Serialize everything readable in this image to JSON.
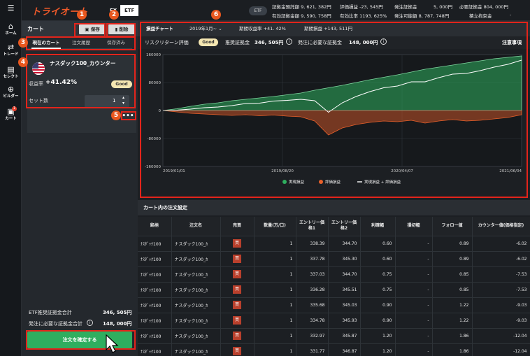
{
  "app": {
    "logo": "トライオート",
    "mode_fx": "FX",
    "mode_etf": "ETF",
    "etf_pill": "ETF"
  },
  "colors": {
    "accent": "#ef5a2a",
    "green": "#2fae5f",
    "red": "#e3241b",
    "panel": "#24282d"
  },
  "rail": [
    {
      "icon": "home-icon",
      "glyph": "⌂",
      "label": "ホーム"
    },
    {
      "icon": "trade-icon",
      "glyph": "⇄",
      "label": "トレード"
    },
    {
      "icon": "select-icon",
      "glyph": "▤",
      "label": "セレクト"
    },
    {
      "icon": "builder-icon",
      "glyph": "⊕",
      "label": "ビルダー"
    },
    {
      "icon": "cart-icon",
      "glyph": "🛒",
      "label": "カート",
      "badge": "1"
    }
  ],
  "summary": {
    "r1c1": "証拠金預託額 9, 621, 382円",
    "r1c2": "評価損益 -23, 545円",
    "r1c3": "発注証拠金",
    "r1c3v": "5, 000円",
    "r1c4": "必要証拠金 804, 000円",
    "r2c1": "有効証拠金額 9, 590, 758円",
    "r2c2": "有効比率 1193. 625%",
    "r2c3": "発注可能額 8, 787, 748円",
    "r2c4": "積立拘束金",
    "r2c4v": "-"
  },
  "cart": {
    "title": "カート",
    "save": "保存",
    "delete": "削除",
    "tabs": [
      "現在のカート",
      "注文履歴",
      "保存済み"
    ],
    "product_name": "ナスダック100_カウンター",
    "return_label": "収益率",
    "return_value": "+41.42%",
    "rating": "Good",
    "sets_label": "セット数",
    "sets_value": "1",
    "more": "•••",
    "etf_margin_label": "ETF推奨証拠金合計",
    "etf_margin_value": "346, 505円",
    "req_margin_label": "発注に必要な証拠金合計",
    "req_margin_value": "148, 000円",
    "confirm": "注文を確定する"
  },
  "callouts": [
    "1",
    "2",
    "3",
    "4",
    "5",
    "6"
  ],
  "chart_panel": {
    "tab": "損益チャート",
    "period": "2019年1月~",
    "period_return": "期間収益率 +41. 42%",
    "period_pnl": "期間損益 +143, 511円",
    "risk_label": "リスクリターン評価",
    "risk_value": "Good",
    "recommended_label": "推奨証拠金",
    "recommended_value": "346, 505円",
    "required_label": "発注に必要な証拠金",
    "required_value": "148, 000円",
    "notes": "注意事項"
  },
  "chart_data": {
    "type": "area",
    "x_ticks": [
      "2019/01/01",
      "2019/08/20",
      "2020/04/07",
      "2021/06/04"
    ],
    "y_ticks": [
      "160000",
      "80000",
      "0",
      "-80000",
      "-160000"
    ],
    "ylim": [
      -160000,
      160000
    ],
    "legend": [
      "実現損益",
      "評価損益",
      "実現損益 + 評価損益"
    ],
    "legend_colors": [
      "#2fae5f",
      "#e8602a",
      "#ffffff"
    ],
    "series": [
      {
        "name": "実現損益",
        "values": [
          0,
          5000,
          12000,
          18000,
          22000,
          28000,
          32000,
          36000,
          40000,
          45000,
          50000,
          58000,
          65000,
          72000,
          80000,
          88000,
          95000,
          102000,
          110000,
          118000,
          124000,
          130000,
          136000,
          142000,
          148000,
          152000,
          156000
        ]
      },
      {
        "name": "評価損益",
        "values": [
          0,
          -4000,
          -8000,
          -10000,
          -12000,
          -14000,
          -12000,
          -15000,
          -13000,
          -16000,
          -18000,
          -30000,
          -70000,
          -50000,
          -40000,
          -34000,
          -30000,
          -32000,
          -28000,
          -36000,
          -30000,
          -26000,
          -30000,
          -28000,
          -24000,
          -20000,
          -12000
        ]
      },
      {
        "name": "実現損益 + 評価損益",
        "values": [
          0,
          1000,
          4000,
          8000,
          10000,
          14000,
          20000,
          21000,
          27000,
          29000,
          32000,
          28000,
          -5000,
          22000,
          40000,
          54000,
          65000,
          70000,
          82000,
          82000,
          94000,
          104000,
          106000,
          114000,
          124000,
          132000,
          144000
        ]
      }
    ]
  },
  "orders": {
    "title": "カート内の注文設定",
    "headers": [
      "銘柄",
      "注文名",
      "売買",
      "数量(万/口)",
      "エントリー価格1",
      "エントリー価格2",
      "利確幅",
      "損切幅",
      "フォロー値",
      "カウンター値(価格指定)"
    ],
    "buy_label": "買",
    "rows": [
      [
        "ﾅｽﾀﾞｯｸ100",
        "ナスダック100_ｶ",
        "1",
        "338.39",
        "344.70",
        "0.60",
        "-",
        "0.89",
        "-6.02"
      ],
      [
        "ﾅｽﾀﾞｯｸ100",
        "ナスダック100_ｶ",
        "1",
        "337.78",
        "345.30",
        "0.60",
        "-",
        "0.89",
        "-6.02"
      ],
      [
        "ﾅｽﾀﾞｯｸ100",
        "ナスダック100_ｶ",
        "1",
        "337.03",
        "344.70",
        "0.75",
        "-",
        "0.85",
        "-7.53"
      ],
      [
        "ﾅｽﾀﾞｯｸ100",
        "ナスダック100_ｶ",
        "1",
        "336.28",
        "345.51",
        "0.75",
        "-",
        "0.85",
        "-7.53"
      ],
      [
        "ﾅｽﾀﾞｯｸ100",
        "ナスダック100_ｶ",
        "1",
        "335.68",
        "345.03",
        "0.90",
        "-",
        "1.22",
        "-9.03"
      ],
      [
        "ﾅｽﾀﾞｯｸ100",
        "ナスダック100_ｶ",
        "1",
        "334.78",
        "345.93",
        "0.90",
        "-",
        "1.22",
        "-9.03"
      ],
      [
        "ﾅｽﾀﾞｯｸ100",
        "ナスダック100_ｶ",
        "1",
        "332.97",
        "345.87",
        "1.20",
        "-",
        "1.86",
        "-12.04"
      ],
      [
        "ﾅｽﾀﾞｯｸ100",
        "ナスダック100_ｶ",
        "1",
        "331.77",
        "346.87",
        "1.20",
        "-",
        "1.86",
        "-12.04"
      ]
    ]
  }
}
